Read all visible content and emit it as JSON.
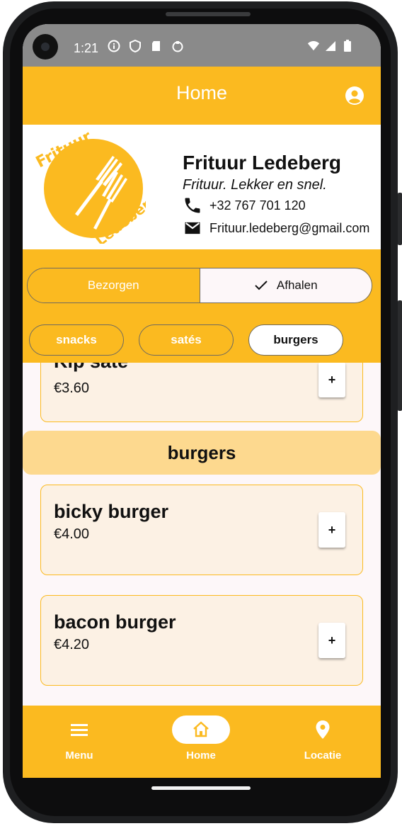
{
  "status_bar": {
    "time": "1:21"
  },
  "app_bar": {
    "title": "Home"
  },
  "restaurant": {
    "logo_text_top": "Frituur",
    "logo_text_bottom": "Ledeberg",
    "name": "Frituur Ledeberg",
    "slogan": "Frituur. Lekker en snel.",
    "phone": "+32 767 701 120",
    "email": "Frituur.ledeberg@gmail.com"
  },
  "delivery_toggle": {
    "options": [
      {
        "label": "Bezorgen",
        "selected": false
      },
      {
        "label": "Afhalen",
        "selected": true
      }
    ]
  },
  "category_chips": [
    {
      "label": "snacks",
      "selected": false
    },
    {
      "label": "satés",
      "selected": false
    },
    {
      "label": "burgers",
      "selected": true
    }
  ],
  "menu": {
    "partial_item": {
      "name": "Kip saté",
      "price": "€3.60"
    },
    "category_header": "burgers",
    "items": [
      {
        "name": "bicky burger",
        "price": "€4.00",
        "add_label": "+"
      },
      {
        "name": "bacon burger",
        "price": "€4.20",
        "add_label": "+"
      }
    ],
    "partial_add_label": "+"
  },
  "bottom_nav": {
    "items": [
      {
        "label": "Menu",
        "icon": "menu-icon",
        "active": false
      },
      {
        "label": "Home",
        "icon": "home-icon",
        "active": true
      },
      {
        "label": "Locatie",
        "icon": "location-pin-icon",
        "active": false
      }
    ]
  },
  "colors": {
    "accent": "#fbba20",
    "card_bg": "#fcf1e4",
    "category_bg": "#fdd98f",
    "status_bar": "#8a8a8a"
  }
}
